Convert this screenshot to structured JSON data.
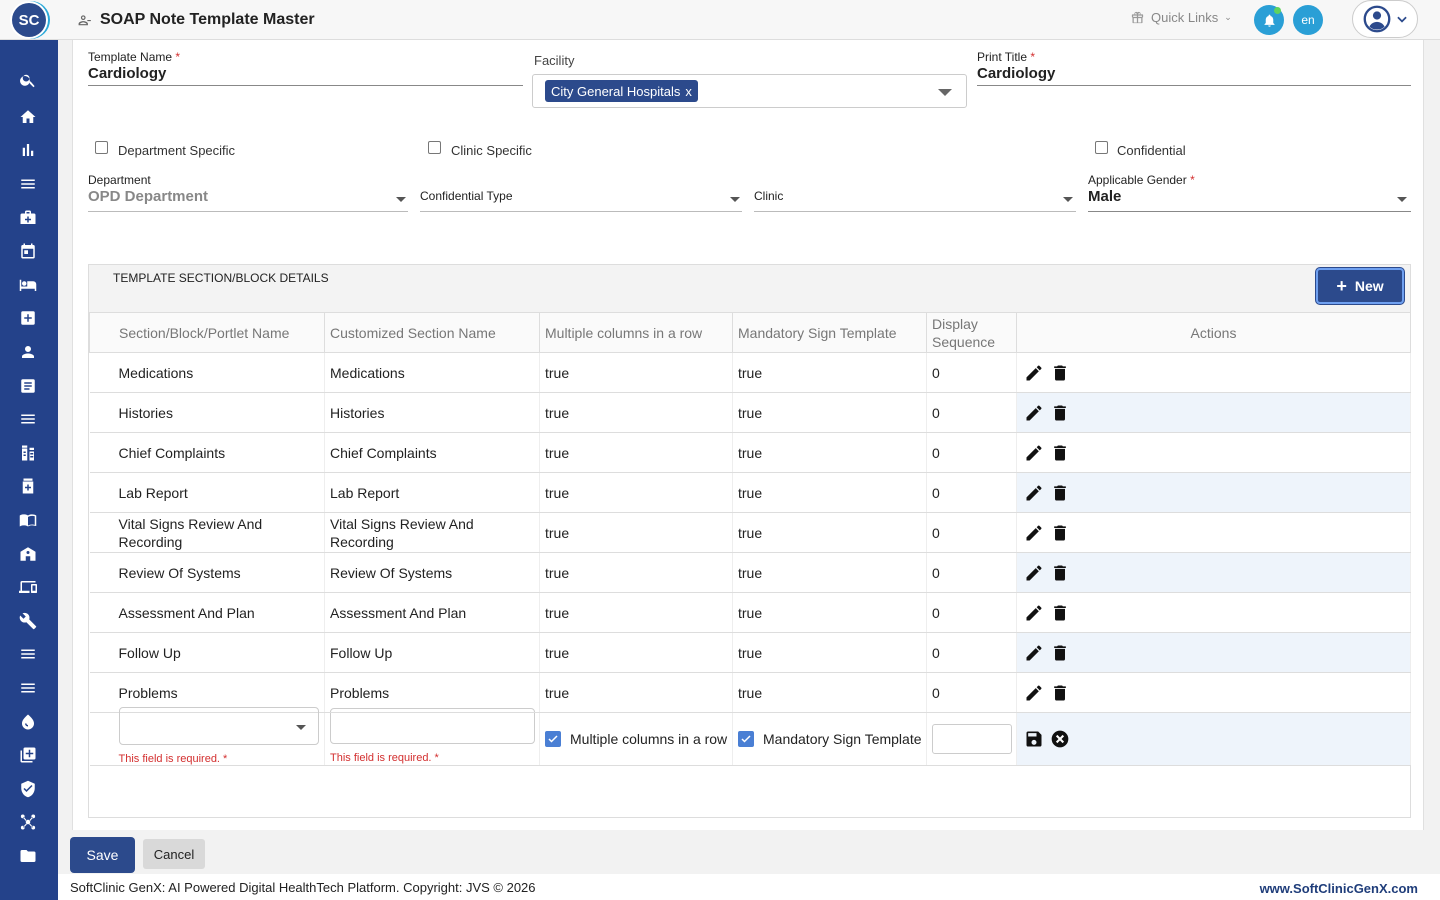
{
  "app": {
    "logo_text": "SC",
    "page_title": "SOAP Note Template Master"
  },
  "header": {
    "quick_links": "Quick Links",
    "lang": "en"
  },
  "form": {
    "template_name_label": "Template Name",
    "template_name_value": "Cardiology",
    "facility_label": "Facility",
    "facility_chip": "City General Hospitals",
    "facility_chip_remove": "x",
    "print_title_label": "Print Title",
    "print_title_value": "Cardiology",
    "req_mark": "*",
    "dept_specific_label": "Department Specific",
    "clinic_specific_label": "Clinic Specific",
    "confidential_label": "Confidential",
    "department_label": "Department",
    "department_value": "OPD Department",
    "confidential_type_label": "Confidential Type",
    "clinic_label": "Clinic",
    "gender_label": "Applicable Gender",
    "gender_value": "Male"
  },
  "section": {
    "title": "TEMPLATE SECTION/BLOCK DETAILS",
    "new_label": "New",
    "columns": [
      "Section/Block/Portlet Name",
      "Customized Section Name",
      "Multiple columns in a row",
      "Mandatory Sign Template",
      "Display Sequence",
      "Actions"
    ],
    "rows": [
      [
        "Medications",
        "Medications",
        "true",
        "true",
        "0"
      ],
      [
        "Histories",
        "Histories",
        "true",
        "true",
        "0"
      ],
      [
        "Chief Complaints",
        "Chief Complaints",
        "true",
        "true",
        "0"
      ],
      [
        "Lab Report",
        "Lab Report",
        "true",
        "true",
        "0"
      ],
      [
        "Vital Signs Review And Recording",
        "Vital Signs Review And Recording",
        "true",
        "true",
        "0"
      ],
      [
        "Review Of Systems",
        "Review Of Systems",
        "true",
        "true",
        "0"
      ],
      [
        "Assessment And Plan",
        "Assessment And Plan",
        "true",
        "true",
        "0"
      ],
      [
        "Follow Up",
        "Follow Up",
        "true",
        "true",
        "0"
      ],
      [
        "Problems",
        "Problems",
        "true",
        "true",
        "0"
      ]
    ],
    "edit_row": {
      "error_text": "This field is required. *",
      "multi_col_label": "Multiple columns in a row",
      "mandatory_label": "Mandatory Sign Template"
    }
  },
  "footer": {
    "save_label": "Save",
    "cancel_label": "Cancel",
    "copyright": "SoftClinic GenX: AI Powered Digital HealthTech Platform. Copyright: JVS © 2026",
    "site": "www.SoftClinicGenX.com"
  },
  "colors": {
    "brand": "#2c4a8c",
    "sidebar": "#24428a",
    "accent": "#2a9fd6",
    "error": "#d32f2f"
  },
  "sidebar_icons": [
    "search-icon",
    "home-icon",
    "bar-chart-icon",
    "menu-icon",
    "medical-bag-icon",
    "calendar-icon",
    "bed-icon",
    "medical-plus-icon",
    "person-icon",
    "document-list-icon",
    "menu-icon",
    "pharmacy-icon",
    "medicine-bottle-icon",
    "book-icon",
    "building-icon",
    "devices-icon",
    "wrench-icon",
    "menu-icon",
    "menu-icon",
    "drop-icon",
    "add-box-icon",
    "shield-icon",
    "network-icon",
    "folder-icon"
  ]
}
